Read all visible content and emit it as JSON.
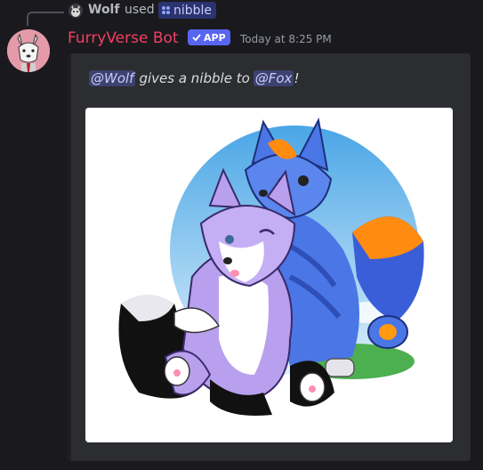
{
  "reply": {
    "user": "Wolf",
    "used_text": "used",
    "command": "nibble"
  },
  "message": {
    "bot_name": "FurryVerse Bot",
    "app_badge": "APP",
    "timestamp": "Today at 8:25 PM"
  },
  "embed": {
    "mention_from": "@Wolf",
    "action_text": "gives a nibble to",
    "mention_to": "@Fox",
    "end_punct": "!"
  },
  "colors": {
    "background": "#1a1a1e",
    "embed_bg": "#2b2d31",
    "bot_name": "#f23f62",
    "app_badge": "#5865f2",
    "mention_bg": "#3c4270"
  }
}
